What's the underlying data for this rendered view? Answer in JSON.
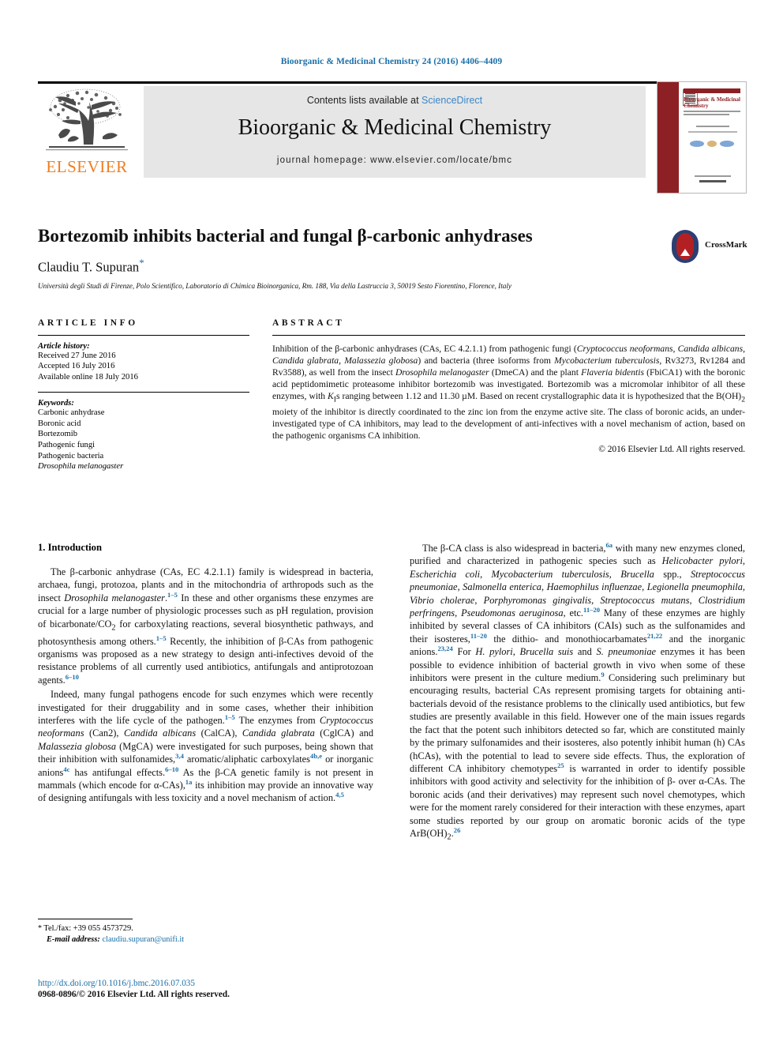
{
  "running_head": "Bioorganic & Medicinal Chemistry 24 (2016) 4406–4409",
  "masthead": {
    "contents_prefix": "Contents lists available at ",
    "sciencedirect": "ScienceDirect",
    "journal_title": "Bioorganic & Medicinal Chemistry",
    "homepage": "journal homepage: www.elsevier.com/locate/bmc",
    "publisher_name": "ELSEVIER",
    "cover_title": "Bioorganic & Medicinal Chemistry"
  },
  "crossmark": {
    "label": "CrossMark"
  },
  "title_block": {
    "title": "Bortezomib inhibits bacterial and fungal β-carbonic anhydrases",
    "author": "Claudiu T. Supuran",
    "author_marker": "*",
    "affiliation": "Università degli Studi di Firenze, Polo Scientifico, Laboratorio di Chimica Bioinorganica, Rm. 188, Via della Lastruccia 3, 50019 Sesto Fiorentino, Florence, Italy"
  },
  "article_info": {
    "heading": "ARTICLE INFO",
    "history_label": "Article history:",
    "history": [
      "Received 27 June 2016",
      "Accepted 16 July 2016",
      "Available online 18 July 2016"
    ],
    "keywords_label": "Keywords:",
    "keywords": [
      "Carbonic anhydrase",
      "Boronic acid",
      "Bortezomib",
      "Pathogenic fungi",
      "Pathogenic bacteria",
      "Drosophila melanogaster"
    ],
    "keyword_italic_index": 5
  },
  "abstract": {
    "heading": "ABSTRACT",
    "copyright": "© 2016 Elsevier Ltd. All rights reserved."
  },
  "sections": {
    "intro_heading": "1. Introduction"
  },
  "footnote": {
    "tel": "Tel./fax: +39 055 4573729.",
    "email_label": "E-mail address:",
    "email": "claudiu.supuran@unifi.it",
    "marker": "*"
  },
  "footer": {
    "doi": "http://dx.doi.org/10.1016/j.bmc.2016.07.035",
    "issn": "0968-0896/© 2016 Elsevier Ltd. All rights reserved."
  },
  "colors": {
    "link_blue": "#1a6fa8",
    "sciencedirect_blue": "#3a87c8",
    "elsevier_orange": "#F07C20",
    "crossmark_red": "#b32024",
    "crossmark_blue": "#2b3f72"
  }
}
